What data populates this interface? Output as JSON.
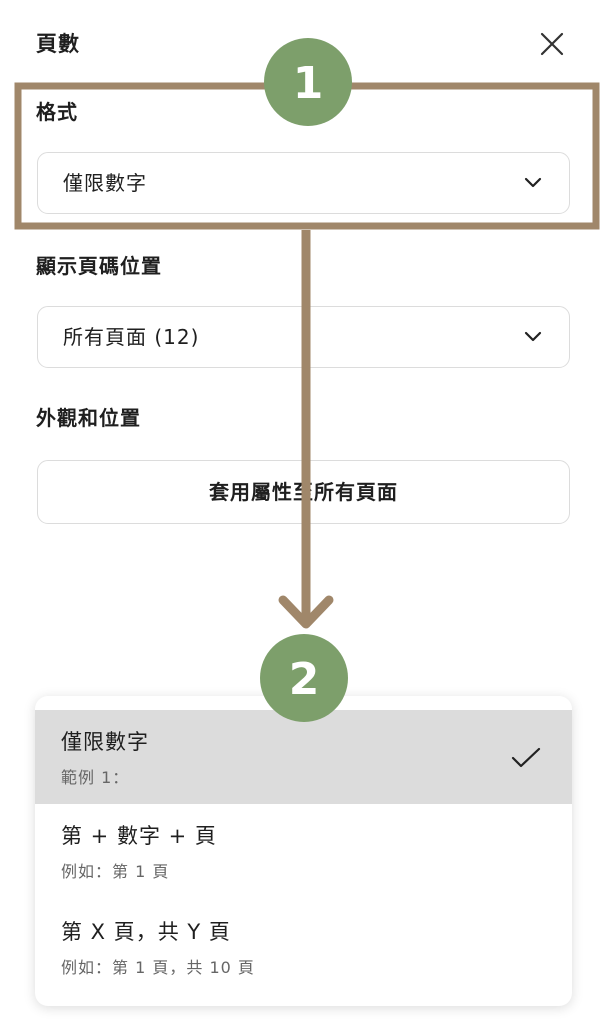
{
  "panel": {
    "title": "頁數",
    "close_icon": "close-icon"
  },
  "format": {
    "label": "格式",
    "selected": "僅限數字",
    "icon": "chevron-down-icon"
  },
  "display": {
    "label": "顯示頁碼位置",
    "selected": "所有頁面 (12)",
    "icon": "chevron-down-icon"
  },
  "appearance": {
    "label": "外觀和位置",
    "apply_button": "套用屬性至所有頁面"
  },
  "dropdown": {
    "options": [
      {
        "label": "僅限數字",
        "example": "範例 1：",
        "selected": true
      },
      {
        "label": "第 + 數字 + 頁",
        "example": "例如：第 1 頁",
        "selected": false
      },
      {
        "label": "第 X 頁，共 Y 頁",
        "example": "例如：第 1 頁，共 10 頁",
        "selected": false
      }
    ],
    "check_icon": "checkmark-icon"
  },
  "annotations": {
    "badge_1": "1",
    "badge_2": "2",
    "accent_color": "#a0876a",
    "badge_color": "#7d9f6b"
  }
}
